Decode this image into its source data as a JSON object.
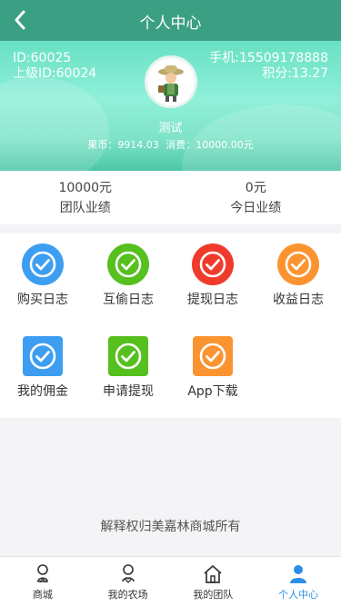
{
  "header": {
    "title": "个人中心",
    "back_icon": "chevron-left-icon"
  },
  "profile": {
    "id_text": "ID:60025",
    "parent_id_text": "上级ID:60024",
    "phone_text": "手机:15509178888",
    "points_text": "积分:13.27",
    "nickname": "测试",
    "fruit_coins": "果币：9914.03",
    "consumption": "消费：10000.00元"
  },
  "stats": [
    {
      "value": "10000元",
      "label": "团队业绩"
    },
    {
      "value": "0元",
      "label": "今日业绩"
    }
  ],
  "menu": [
    {
      "label": "购买日志",
      "color": "#3d9ef1",
      "shape": "circle",
      "icon": "check-circle-icon"
    },
    {
      "label": "互偷日志",
      "color": "#55c01e",
      "shape": "circle",
      "icon": "check-circle-icon"
    },
    {
      "label": "提现日志",
      "color": "#ef3a2c",
      "shape": "circle",
      "icon": "check-circle-icon"
    },
    {
      "label": "收益日志",
      "color": "#fb9430",
      "shape": "circle",
      "icon": "check-circle-icon"
    },
    {
      "label": "我的佣金",
      "color": "#3d9ef1",
      "shape": "square",
      "icon": "check-circle-icon"
    },
    {
      "label": "申请提现",
      "color": "#55c01e",
      "shape": "square",
      "icon": "check-circle-icon"
    },
    {
      "label": "App下载",
      "color": "#fb9430",
      "shape": "square",
      "icon": "check-circle-icon"
    }
  ],
  "footer_note": "解释权归美嘉林商城所有",
  "tabbar": [
    {
      "label": "商城",
      "icon": "shop-icon",
      "active": false
    },
    {
      "label": "我的农场",
      "icon": "farm-icon",
      "active": false
    },
    {
      "label": "我的团队",
      "icon": "home-icon",
      "active": false
    },
    {
      "label": "个人中心",
      "icon": "user-icon",
      "active": true
    }
  ],
  "colors": {
    "header": "#3b9f83",
    "active_tab": "#2a8fe6"
  }
}
